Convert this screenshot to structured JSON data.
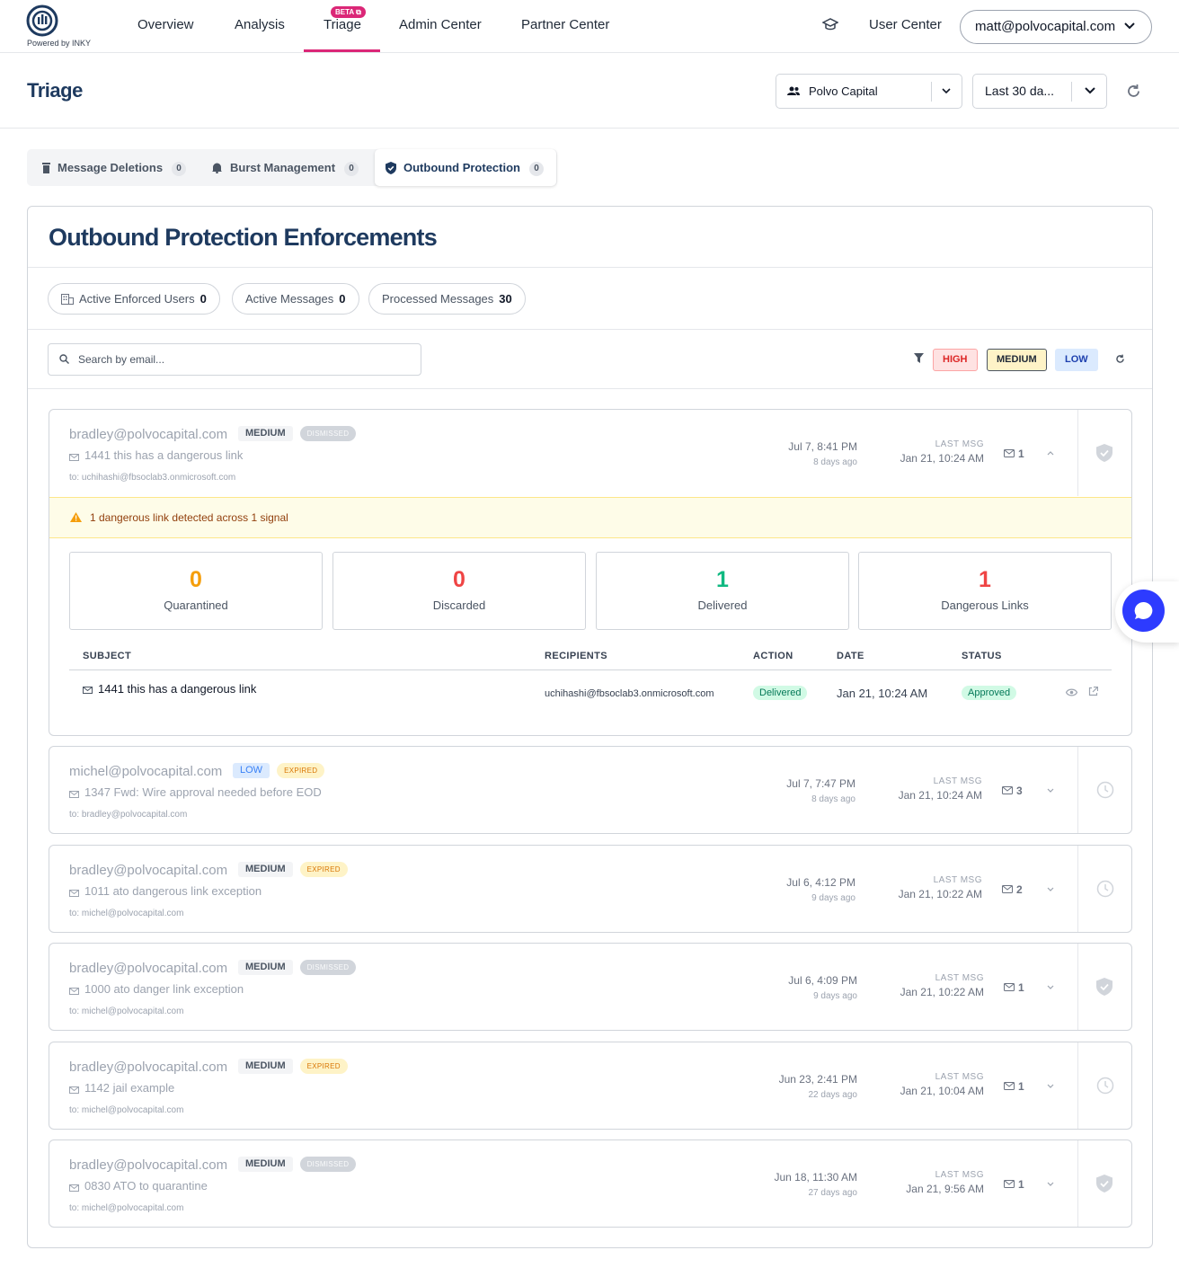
{
  "brand": {
    "powered_by": "Powered by INKY"
  },
  "nav": {
    "items": [
      {
        "label": "Overview"
      },
      {
        "label": "Analysis"
      },
      {
        "label": "Triage"
      },
      {
        "label": "Admin Center"
      },
      {
        "label": "Partner Center"
      }
    ],
    "beta_label": "BETA",
    "user_center": "User Center",
    "user_email": "matt@polvocapital.com"
  },
  "header": {
    "title": "Triage",
    "org_select": "Polvo Capital",
    "date_select": "Last 30 da..."
  },
  "tabs": [
    {
      "label": "Message Deletions",
      "count": "0"
    },
    {
      "label": "Burst Management",
      "count": "0"
    },
    {
      "label": "Outbound Protection",
      "count": "0"
    }
  ],
  "main": {
    "title": "Outbound Protection Enforcements",
    "stats": [
      {
        "label": "Active Enforced Users",
        "value": "0"
      },
      {
        "label": "Active Messages",
        "value": "0"
      },
      {
        "label": "Processed Messages",
        "value": "30"
      }
    ],
    "search_placeholder": "Search by email...",
    "severity_filters": [
      "HIGH",
      "MEDIUM",
      "LOW"
    ],
    "last_msg_label": "LAST MSG"
  },
  "rows": [
    {
      "email": "bradley@polvocapital.com",
      "severity": "MEDIUM",
      "status": "DISMISSED",
      "subject": "1441 this has a dangerous link",
      "to": "to: uchihashi@fbsoclab3.onmicrosoft.com",
      "date": "Jul 7, 8:41 PM",
      "ago": "8 days ago",
      "last": "Jan 21, 10:24 AM",
      "count": "1"
    },
    {
      "email": "michel@polvocapital.com",
      "severity": "LOW",
      "status": "EXPIRED",
      "subject": "1347 Fwd: Wire approval needed before EOD",
      "to": "to: bradley@polvocapital.com",
      "date": "Jul 7, 7:47 PM",
      "ago": "8 days ago",
      "last": "Jan 21, 10:24 AM",
      "count": "3"
    },
    {
      "email": "bradley@polvocapital.com",
      "severity": "MEDIUM",
      "status": "EXPIRED",
      "subject": "1011 ato dangerous link exception",
      "to": "to: michel@polvocapital.com",
      "date": "Jul 6, 4:12 PM",
      "ago": "9 days ago",
      "last": "Jan 21, 10:22 AM",
      "count": "2"
    },
    {
      "email": "bradley@polvocapital.com",
      "severity": "MEDIUM",
      "status": "DISMISSED",
      "subject": "1000 ato danger link exception",
      "to": "to: michel@polvocapital.com",
      "date": "Jul 6, 4:09 PM",
      "ago": "9 days ago",
      "last": "Jan 21, 10:22 AM",
      "count": "1"
    },
    {
      "email": "bradley@polvocapital.com",
      "severity": "MEDIUM",
      "status": "EXPIRED",
      "subject": "1142 jail example",
      "to": "to: michel@polvocapital.com",
      "date": "Jun 23, 2:41 PM",
      "ago": "22 days ago",
      "last": "Jan 21, 10:04 AM",
      "count": "1"
    },
    {
      "email": "bradley@polvocapital.com",
      "severity": "MEDIUM",
      "status": "DISMISSED",
      "subject": "0830 ATO to quarantine",
      "to": "to: michel@polvocapital.com",
      "date": "Jun 18, 11:30 AM",
      "ago": "27 days ago",
      "last": "Jan 21, 9:56 AM",
      "count": "1"
    }
  ],
  "expanded": {
    "alert": "1 dangerous link detected across 1 signal",
    "boxes": [
      {
        "value": "0",
        "label": "Quarantined",
        "color": "#f59e0b"
      },
      {
        "value": "0",
        "label": "Discarded",
        "color": "#ef4444"
      },
      {
        "value": "1",
        "label": "Delivered",
        "color": "#10b981"
      },
      {
        "value": "1",
        "label": "Dangerous Links",
        "color": "#ef4444"
      }
    ],
    "columns": [
      "SUBJECT",
      "RECIPIENTS",
      "ACTION",
      "DATE",
      "STATUS"
    ],
    "message": {
      "subject": "1441 this has a dangerous link",
      "recipients": "uchihashi@fbsoclab3.onmicrosoft.com",
      "action": "Delivered",
      "date": "Jan 21, 10:24 AM",
      "status": "Approved"
    }
  }
}
